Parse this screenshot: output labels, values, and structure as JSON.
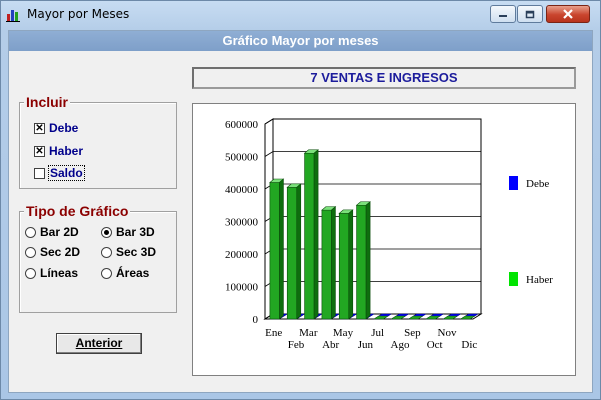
{
  "window": {
    "title": "Mayor por Meses"
  },
  "header": {
    "title": "Gráfico Mayor por meses"
  },
  "series_box": {
    "text": "7   VENTAS E INGRESOS"
  },
  "incluir": {
    "title": "Incluir",
    "options": [
      {
        "label": "Debe",
        "checked": true
      },
      {
        "label": "Haber",
        "checked": true
      },
      {
        "label": "Saldo",
        "checked": false
      }
    ]
  },
  "tipo": {
    "title": "Tipo de Gráfico",
    "options": [
      {
        "label": "Bar 2D",
        "selected": false
      },
      {
        "label": "Bar 3D",
        "selected": true
      },
      {
        "label": "Sec 2D",
        "selected": false
      },
      {
        "label": "Sec 3D",
        "selected": false
      },
      {
        "label": "Líneas",
        "selected": false
      },
      {
        "label": "Áreas",
        "selected": false
      }
    ]
  },
  "buttons": {
    "anterior": "Anterior"
  },
  "chart_data": {
    "type": "bar",
    "categories": [
      "Ene",
      "Feb",
      "Mar",
      "Abr",
      "May",
      "Jun",
      "Jul",
      "Ago",
      "Sep",
      "Oct",
      "Nov",
      "Dic"
    ],
    "series": [
      {
        "name": "Debe",
        "values": [
          0,
          0,
          0,
          0,
          0,
          0,
          0,
          0,
          0,
          0,
          0,
          0
        ],
        "color": "#0000ff"
      },
      {
        "name": "Haber",
        "values": [
          420000,
          405000,
          510000,
          335000,
          325000,
          350000,
          0,
          0,
          0,
          0,
          0,
          0
        ],
        "color": "#22a722"
      }
    ],
    "yticks": [
      "0",
      "100000",
      "200000",
      "300000",
      "400000",
      "500000",
      "600000"
    ],
    "ylim": [
      0,
      600000
    ],
    "grid": true,
    "legend": "right"
  }
}
